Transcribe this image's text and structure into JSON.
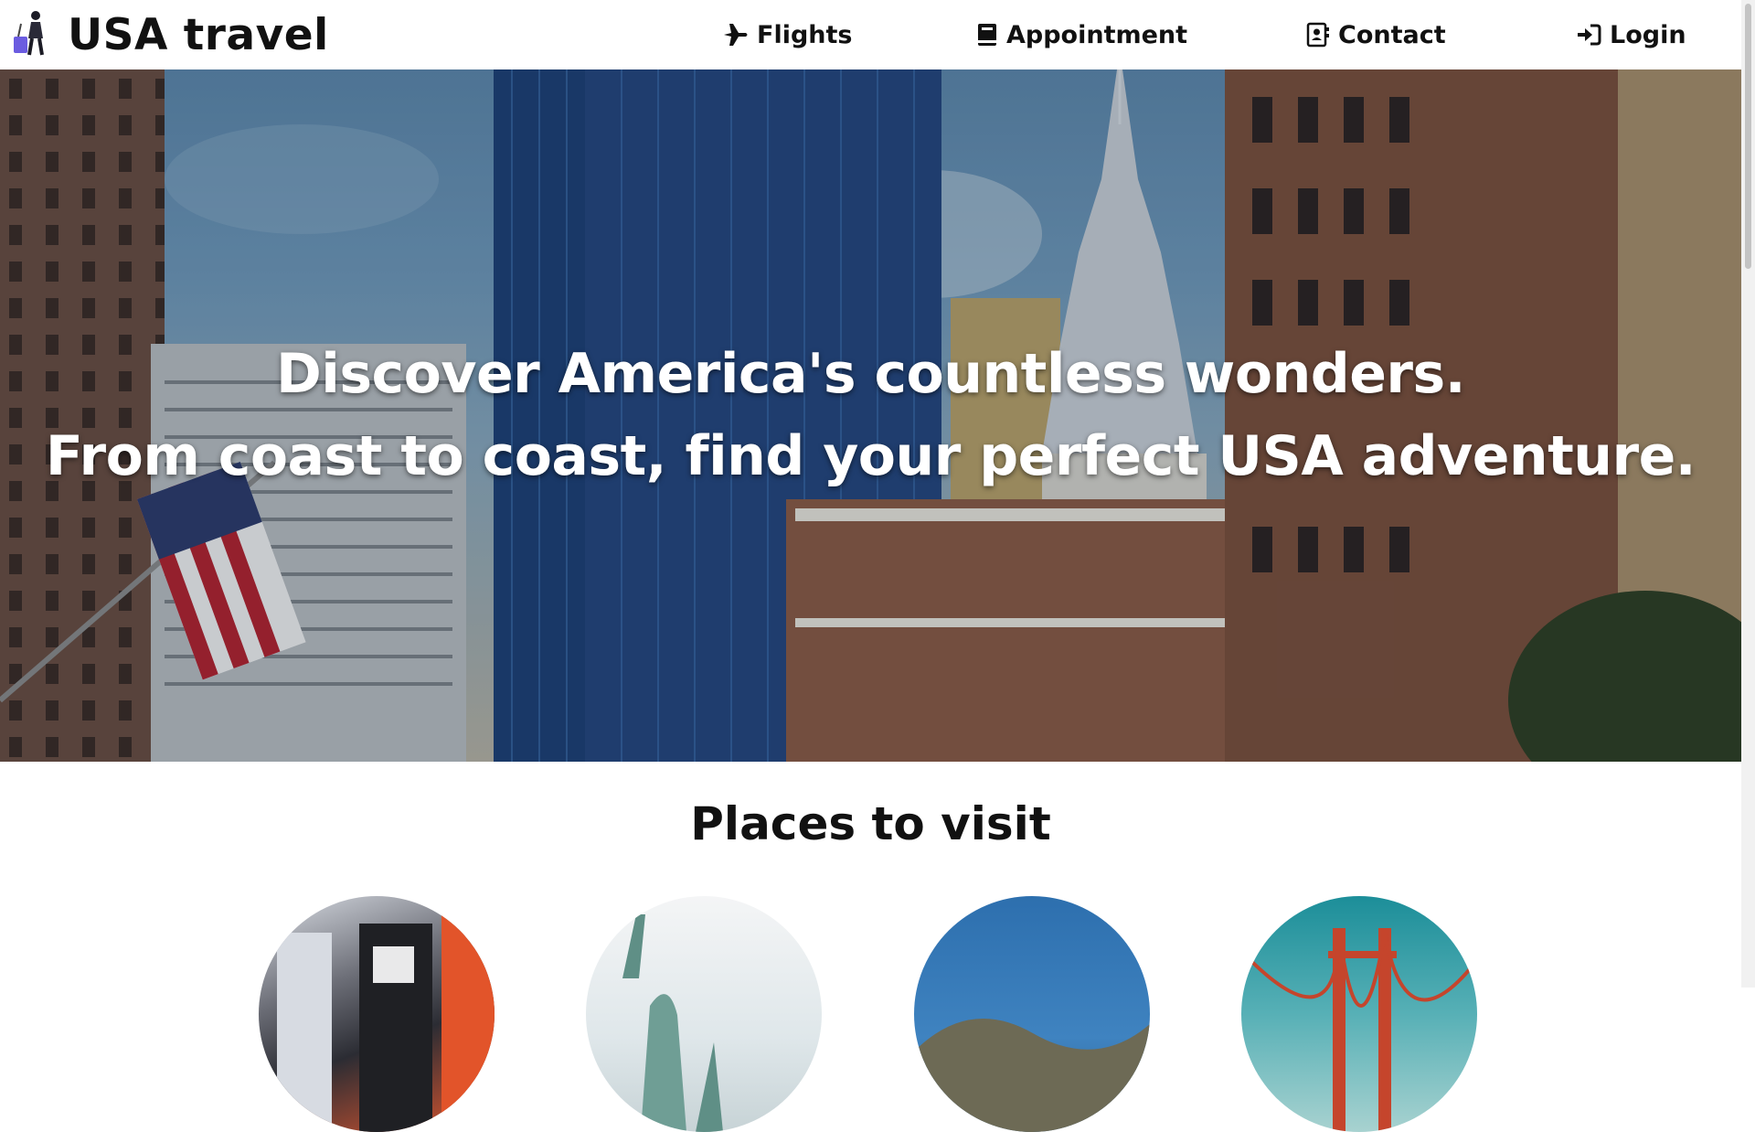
{
  "header": {
    "brand": "USA travel",
    "nav": {
      "flights": "Flights",
      "appointment": "Appointment",
      "contact": "Contact",
      "login": "Login"
    }
  },
  "hero": {
    "line1": "Discover America's countless wonders.",
    "line2": "From coast to coast, find your perfect USA adventure."
  },
  "places": {
    "title": "Places to visit"
  },
  "icons": {
    "brand": "traveler-with-suitcase-icon",
    "flights": "airplane-icon",
    "appointment": "book-icon",
    "contact": "contact-card-icon",
    "login": "sign-in-icon"
  }
}
